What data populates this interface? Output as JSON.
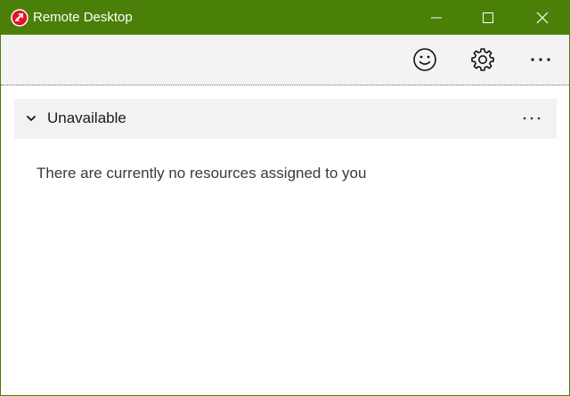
{
  "window": {
    "title": "Remote Desktop",
    "accent": "#4a7f08"
  },
  "toolbar": {
    "feedback_icon": "smiley-icon",
    "settings_icon": "gear-icon",
    "more_icon": "more-horizontal-icon"
  },
  "group": {
    "title": "Unavailable",
    "expanded": true
  },
  "content": {
    "empty_message": "There are currently no resources assigned to you"
  }
}
